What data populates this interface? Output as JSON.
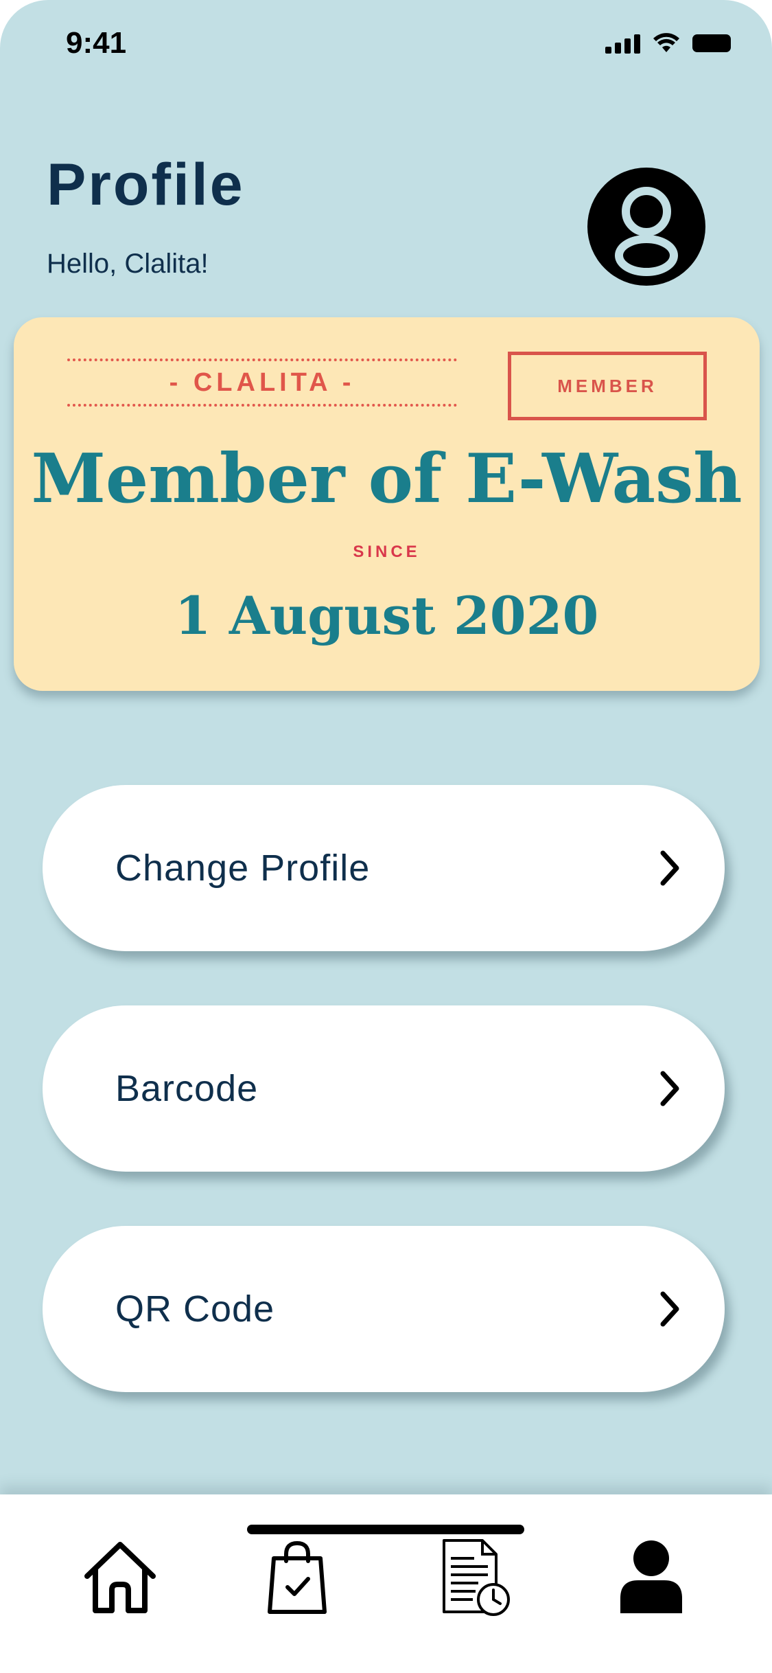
{
  "status_bar": {
    "time": "9:41"
  },
  "header": {
    "title": "Profile",
    "greeting": "Hello, Clalita!"
  },
  "card": {
    "name": "- CLALITA -",
    "badge": "MEMBER",
    "headline": "Member of E-Wash",
    "since_label": "SINCE",
    "since_date": "1 August 2020"
  },
  "menu": {
    "items": [
      {
        "label": "Change Profile",
        "icon": "chevron-right-icon"
      },
      {
        "label": "Barcode",
        "icon": "chevron-right-icon"
      },
      {
        "label": "QR Code",
        "icon": "chevron-right-icon"
      }
    ]
  },
  "tabbar": {
    "tabs": [
      {
        "icon": "home-icon"
      },
      {
        "icon": "shopping-bag-check-icon"
      },
      {
        "icon": "document-clock-icon"
      },
      {
        "icon": "user-icon",
        "active": true
      }
    ]
  },
  "colors": {
    "background": "#c2dfe4",
    "primary_text": "#0f2f4c",
    "card_bg": "#fde7b6",
    "card_accent": "#1a7e8c",
    "card_red": "#d9544b"
  }
}
